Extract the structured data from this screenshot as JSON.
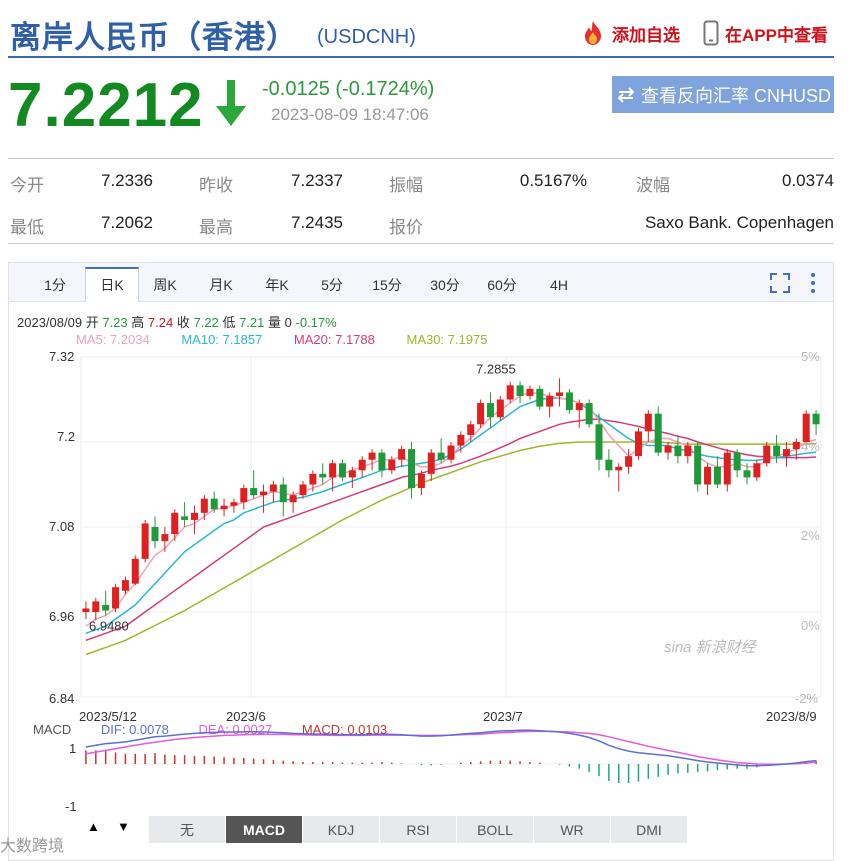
{
  "header": {
    "title": "离岸人民币（香港）",
    "code": "(USDCNH)",
    "add_fav": "添加自选",
    "view_app": "在APP中查看"
  },
  "quote": {
    "price": "7.2212",
    "change": "-0.0125 (-0.1724%)",
    "time": "2023-08-09 18:47:06",
    "reverse_btn": "查看反向汇率 CNHUSD",
    "direction": "down"
  },
  "stats": {
    "open_label": "今开",
    "open": "7.2336",
    "prev_label": "昨收",
    "prev": "7.2337",
    "amp_label": "振幅",
    "amp": "0.5167%",
    "wave_label": "波幅",
    "wave": "0.0374",
    "low_label": "最低",
    "low": "7.2062",
    "high_label": "最高",
    "high": "7.2435",
    "quote_label": "报价",
    "quote_src": "Saxo Bank. Copenhagen"
  },
  "tabs": [
    "1分",
    "日K",
    "周K",
    "月K",
    "年K",
    "5分",
    "15分",
    "30分",
    "60分",
    "4H"
  ],
  "active_tab": "日K",
  "ohlc": {
    "date": "2023/08/09",
    "open_label": "开",
    "open": "7.23",
    "high_label": "高",
    "high": "7.24",
    "close_label": "收",
    "close": "7.22",
    "low_label": "低",
    "low": "7.21",
    "vol_label": "量",
    "vol": "0",
    "pct": "-0.17%"
  },
  "ma": {
    "ma5": "MA5: 7.2034",
    "ma10": "MA10: 7.1857",
    "ma20": "MA20: 7.1788",
    "ma30": "MA30: 7.1975"
  },
  "colors": {
    "up": "#e02020",
    "down": "#1f9a3a",
    "ma5": "#f0a0b8",
    "ma10": "#29b6d6",
    "ma20": "#d63a78",
    "ma30": "#a3b52a",
    "dif": "#5c6fd6",
    "dea": "#e85ad8"
  },
  "chart_data": {
    "type": "candlestick",
    "y_ticks": [
      "7.32",
      "7.2",
      "7.08",
      "6.96",
      "6.84"
    ],
    "y_right_ticks": [
      "5%",
      "4%",
      "2%",
      "0%",
      "-2%"
    ],
    "ylim": [
      6.84,
      7.32
    ],
    "x_ticks": [
      "2023/5/12",
      "2023/6",
      "2023/7",
      "2023/8/9"
    ],
    "max_label": "7.2855",
    "min_label": "6.9480",
    "candles": [
      [
        6.96,
        6.975,
        6.95,
        6.965
      ],
      [
        6.96,
        6.98,
        6.948,
        6.975
      ],
      [
        6.97,
        6.99,
        6.955,
        6.962
      ],
      [
        6.965,
        7.0,
        6.96,
        6.995
      ],
      [
        6.99,
        7.01,
        6.985,
        7.005
      ],
      [
        7.0,
        7.04,
        6.998,
        7.035
      ],
      [
        7.035,
        7.09,
        7.03,
        7.085
      ],
      [
        7.08,
        7.095,
        7.05,
        7.06
      ],
      [
        7.06,
        7.08,
        7.045,
        7.07
      ],
      [
        7.07,
        7.105,
        7.06,
        7.1
      ],
      [
        7.095,
        7.115,
        7.08,
        7.09
      ],
      [
        7.09,
        7.11,
        7.07,
        7.1
      ],
      [
        7.1,
        7.125,
        7.09,
        7.12
      ],
      [
        7.12,
        7.13,
        7.1,
        7.105
      ],
      [
        7.105,
        7.12,
        7.095,
        7.11
      ],
      [
        7.11,
        7.12,
        7.1,
        7.115
      ],
      [
        7.115,
        7.14,
        7.105,
        7.135
      ],
      [
        7.135,
        7.16,
        7.12,
        7.125
      ],
      [
        7.125,
        7.14,
        7.1,
        7.13
      ],
      [
        7.13,
        7.145,
        7.115,
        7.14
      ],
      [
        7.14,
        7.15,
        7.095,
        7.115
      ],
      [
        7.115,
        7.13,
        7.1,
        7.125
      ],
      [
        7.125,
        7.145,
        7.12,
        7.14
      ],
      [
        7.14,
        7.16,
        7.13,
        7.155
      ],
      [
        7.155,
        7.17,
        7.14,
        7.15
      ],
      [
        7.15,
        7.175,
        7.13,
        7.17
      ],
      [
        7.17,
        7.175,
        7.145,
        7.15
      ],
      [
        7.15,
        7.165,
        7.135,
        7.16
      ],
      [
        7.16,
        7.18,
        7.15,
        7.175
      ],
      [
        7.175,
        7.19,
        7.16,
        7.185
      ],
      [
        7.185,
        7.19,
        7.15,
        7.16
      ],
      [
        7.16,
        7.18,
        7.155,
        7.175
      ],
      [
        7.175,
        7.195,
        7.165,
        7.19
      ],
      [
        7.19,
        7.2,
        7.12,
        7.135
      ],
      [
        7.135,
        7.16,
        7.125,
        7.155
      ],
      [
        7.155,
        7.19,
        7.145,
        7.185
      ],
      [
        7.185,
        7.205,
        7.17,
        7.175
      ],
      [
        7.175,
        7.2,
        7.17,
        7.195
      ],
      [
        7.195,
        7.215,
        7.185,
        7.21
      ],
      [
        7.21,
        7.23,
        7.2,
        7.225
      ],
      [
        7.225,
        7.26,
        7.22,
        7.255
      ],
      [
        7.255,
        7.27,
        7.22,
        7.235
      ],
      [
        7.235,
        7.265,
        7.23,
        7.26
      ],
      [
        7.26,
        7.285,
        7.255,
        7.28
      ],
      [
        7.28,
        7.2855,
        7.255,
        7.265
      ],
      [
        7.265,
        7.28,
        7.26,
        7.275
      ],
      [
        7.275,
        7.28,
        7.245,
        7.25
      ],
      [
        7.25,
        7.27,
        7.235,
        7.265
      ],
      [
        7.265,
        7.29,
        7.25,
        7.27
      ],
      [
        7.27,
        7.275,
        7.24,
        7.245
      ],
      [
        7.245,
        7.26,
        7.22,
        7.255
      ],
      [
        7.255,
        7.26,
        7.22,
        7.225
      ],
      [
        7.225,
        7.24,
        7.16,
        7.175
      ],
      [
        7.175,
        7.19,
        7.15,
        7.16
      ],
      [
        7.16,
        7.17,
        7.13,
        7.165
      ],
      [
        7.165,
        7.19,
        7.155,
        7.18
      ],
      [
        7.18,
        7.22,
        7.175,
        7.215
      ],
      [
        7.215,
        7.245,
        7.2,
        7.24
      ],
      [
        7.24,
        7.25,
        7.18,
        7.185
      ],
      [
        7.185,
        7.2,
        7.175,
        7.195
      ],
      [
        7.195,
        7.21,
        7.17,
        7.18
      ],
      [
        7.18,
        7.2,
        7.17,
        7.195
      ],
      [
        7.195,
        7.2,
        7.13,
        7.14
      ],
      [
        7.14,
        7.17,
        7.125,
        7.165
      ],
      [
        7.165,
        7.18,
        7.135,
        7.14
      ],
      [
        7.14,
        7.19,
        7.13,
        7.185
      ],
      [
        7.185,
        7.19,
        7.15,
        7.16
      ],
      [
        7.16,
        7.17,
        7.14,
        7.15
      ],
      [
        7.15,
        7.175,
        7.145,
        7.17
      ],
      [
        7.17,
        7.2,
        7.165,
        7.195
      ],
      [
        7.195,
        7.21,
        7.17,
        7.18
      ],
      [
        7.18,
        7.2,
        7.165,
        7.19
      ],
      [
        7.19,
        7.205,
        7.175,
        7.2
      ],
      [
        7.2,
        7.245,
        7.19,
        7.24
      ],
      [
        7.24,
        7.245,
        7.21,
        7.225
      ]
    ],
    "ma5": [
      6.94,
      6.95,
      6.955,
      6.965,
      6.985,
      7.0,
      7.02,
      7.04,
      7.05,
      7.065,
      7.08,
      7.085,
      7.095,
      7.105,
      7.107,
      7.11,
      7.115,
      7.12,
      7.125,
      7.13,
      7.128,
      7.125,
      7.13,
      7.135,
      7.14,
      7.15,
      7.155,
      7.16,
      7.165,
      7.17,
      7.175,
      7.175,
      7.18,
      7.17,
      7.165,
      7.165,
      7.17,
      7.18,
      7.195,
      7.205,
      7.22,
      7.235,
      7.245,
      7.255,
      7.265,
      7.27,
      7.268,
      7.265,
      7.262,
      7.26,
      7.255,
      7.25,
      7.23,
      7.21,
      7.195,
      7.18,
      7.19,
      7.2,
      7.205,
      7.205,
      7.2,
      7.195,
      7.18,
      7.17,
      7.165,
      7.165,
      7.17,
      7.165,
      7.165,
      7.175,
      7.18,
      7.185,
      7.19,
      7.2,
      7.2034
    ],
    "ma10": [
      6.93,
      6.935,
      6.94,
      6.95,
      6.96,
      6.97,
      6.985,
      7.0,
      7.015,
      7.03,
      7.045,
      7.055,
      7.065,
      7.075,
      7.085,
      7.09,
      7.1,
      7.105,
      7.11,
      7.115,
      7.118,
      7.12,
      7.122,
      7.126,
      7.13,
      7.135,
      7.14,
      7.145,
      7.15,
      7.155,
      7.16,
      7.163,
      7.166,
      7.168,
      7.17,
      7.172,
      7.176,
      7.182,
      7.19,
      7.2,
      7.21,
      7.22,
      7.23,
      7.24,
      7.25,
      7.255,
      7.26,
      7.262,
      7.262,
      7.26,
      7.255,
      7.245,
      7.235,
      7.225,
      7.215,
      7.205,
      7.198,
      7.195,
      7.195,
      7.195,
      7.19,
      7.188,
      7.183,
      7.18,
      7.178,
      7.176,
      7.175,
      7.174,
      7.174,
      7.176,
      7.178,
      7.18,
      7.182,
      7.184,
      7.1857
    ],
    "ma20": [
      6.92,
      6.925,
      6.93,
      6.935,
      6.94,
      6.95,
      6.96,
      6.97,
      6.98,
      6.99,
      7.0,
      7.01,
      7.02,
      7.03,
      7.04,
      7.05,
      7.06,
      7.07,
      7.08,
      7.085,
      7.09,
      7.095,
      7.1,
      7.105,
      7.11,
      7.115,
      7.12,
      7.125,
      7.13,
      7.135,
      7.14,
      7.145,
      7.15,
      7.153,
      7.156,
      7.16,
      7.163,
      7.166,
      7.17,
      7.175,
      7.18,
      7.186,
      7.192,
      7.198,
      7.205,
      7.21,
      7.215,
      7.22,
      7.225,
      7.228,
      7.23,
      7.232,
      7.232,
      7.23,
      7.228,
      7.225,
      7.222,
      7.218,
      7.215,
      7.212,
      7.208,
      7.205,
      7.2,
      7.196,
      7.192,
      7.188,
      7.185,
      7.182,
      7.18,
      7.179,
      7.178,
      7.178,
      7.178,
      7.178,
      7.1788
    ],
    "ma30": [
      6.9,
      6.905,
      6.91,
      6.915,
      6.92,
      6.927,
      6.934,
      6.941,
      6.948,
      6.955,
      6.962,
      6.97,
      6.978,
      6.986,
      6.994,
      7.002,
      7.01,
      7.018,
      7.026,
      7.034,
      7.042,
      7.05,
      7.058,
      7.066,
      7.074,
      7.082,
      7.09,
      7.097,
      7.104,
      7.111,
      7.118,
      7.124,
      7.13,
      7.136,
      7.142,
      7.147,
      7.152,
      7.157,
      7.162,
      7.167,
      7.172,
      7.176,
      7.18,
      7.184,
      7.188,
      7.191,
      7.194,
      7.196,
      7.198,
      7.199,
      7.2,
      7.2,
      7.2,
      7.2,
      7.2,
      7.2,
      7.2,
      7.2,
      7.2,
      7.199,
      7.198,
      7.197,
      7.197,
      7.197,
      7.197,
      7.197,
      7.197,
      7.197,
      7.197,
      7.197,
      7.197,
      7.197,
      7.197,
      7.197,
      7.1975
    ]
  },
  "macd": {
    "label": "MACD",
    "dif": "DIF: 0.0078",
    "dea": "DEA: 0.0027",
    "macd": "MACD: 0.0103",
    "y_ticks": [
      "1",
      "-1"
    ],
    "dif_values": [
      0.5,
      0.55,
      0.6,
      0.62,
      0.65,
      0.7,
      0.75,
      0.8,
      0.82,
      0.85,
      0.88,
      0.9,
      0.92,
      0.93,
      0.94,
      0.94,
      0.95,
      0.95,
      0.94,
      0.93,
      0.92,
      0.9,
      0.89,
      0.88,
      0.88,
      0.87,
      0.86,
      0.86,
      0.86,
      0.87,
      0.88,
      0.87,
      0.86,
      0.84,
      0.82,
      0.82,
      0.83,
      0.85,
      0.88,
      0.9,
      0.92,
      0.95,
      0.97,
      0.98,
      0.99,
      0.99,
      0.98,
      0.96,
      0.94,
      0.9,
      0.85,
      0.78,
      0.68,
      0.55,
      0.45,
      0.38,
      0.33,
      0.3,
      0.27,
      0.24,
      0.2,
      0.15,
      0.1,
      0.06,
      0.03,
      0.0,
      -0.03,
      -0.05,
      -0.05,
      -0.04,
      -0.02,
      0.0,
      0.03,
      0.07,
      0.1
    ],
    "dea_values": [
      0.3,
      0.35,
      0.4,
      0.45,
      0.5,
      0.55,
      0.6,
      0.64,
      0.68,
      0.72,
      0.75,
      0.78,
      0.8,
      0.82,
      0.84,
      0.85,
      0.86,
      0.87,
      0.87,
      0.87,
      0.87,
      0.86,
      0.86,
      0.85,
      0.85,
      0.84,
      0.84,
      0.84,
      0.84,
      0.85,
      0.85,
      0.85,
      0.85,
      0.84,
      0.84,
      0.84,
      0.84,
      0.85,
      0.86,
      0.87,
      0.88,
      0.9,
      0.92,
      0.93,
      0.95,
      0.96,
      0.96,
      0.96,
      0.95,
      0.94,
      0.92,
      0.9,
      0.86,
      0.8,
      0.73,
      0.66,
      0.59,
      0.52,
      0.46,
      0.4,
      0.34,
      0.28,
      0.22,
      0.17,
      0.12,
      0.08,
      0.04,
      0.02,
      0.0,
      -0.01,
      -0.01,
      0.0,
      0.01,
      0.03,
      0.05
    ],
    "hist_values": [
      0.4,
      0.4,
      0.4,
      0.34,
      0.3,
      0.3,
      0.3,
      0.32,
      0.28,
      0.26,
      0.26,
      0.24,
      0.24,
      0.22,
      0.2,
      0.18,
      0.18,
      0.16,
      0.14,
      0.12,
      0.1,
      0.08,
      0.06,
      0.06,
      0.06,
      0.06,
      0.04,
      0.04,
      0.04,
      0.04,
      0.06,
      0.04,
      0.02,
      0.0,
      -0.04,
      -0.04,
      -0.02,
      0.0,
      0.04,
      0.06,
      0.08,
      0.1,
      0.1,
      0.1,
      0.08,
      0.06,
      0.04,
      0.0,
      -0.02,
      -0.08,
      -0.14,
      -0.24,
      -0.36,
      -0.5,
      -0.56,
      -0.56,
      -0.52,
      -0.44,
      -0.38,
      -0.32,
      -0.28,
      -0.26,
      -0.24,
      -0.22,
      -0.18,
      -0.16,
      -0.14,
      -0.14,
      -0.1,
      -0.06,
      -0.02,
      0.0,
      0.04,
      0.08,
      0.1
    ]
  },
  "indicators": [
    "无",
    "MACD",
    "KDJ",
    "RSI",
    "BOLL",
    "WR",
    "DMI"
  ],
  "active_indicator": "MACD",
  "watermark": "大数跨境",
  "logo_wm": "sina 新浪财经"
}
